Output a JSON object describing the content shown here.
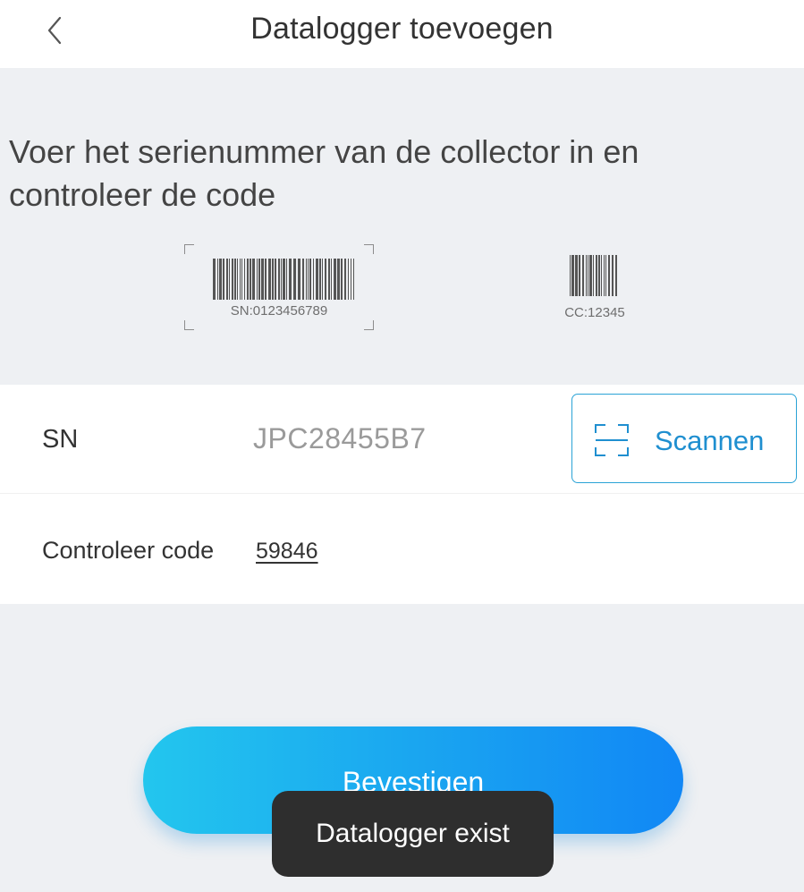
{
  "header": {
    "title": "Datalogger toevoegen"
  },
  "info": {
    "instruction": "Voer het serienummer van de collector in en controleer de code",
    "sn_example_label": "SN:0123456789",
    "cc_example_label": "CC:12345"
  },
  "sn_row": {
    "label": "SN",
    "value": "JPC28455B7",
    "scan_button_label": "Scannen"
  },
  "code_row": {
    "label": "Controleer code",
    "value": "59846"
  },
  "confirm_button": {
    "label": "Bevestigen"
  },
  "toast": {
    "text": "Datalogger exist"
  },
  "colors": {
    "accent": "#1f8fd0",
    "panel_background": "#eef0f3",
    "button_gradient_start": "#23c6ee",
    "button_gradient_end": "#1187f5",
    "toast_background": "#2e2e2e"
  },
  "icons": {
    "back": "chevron-left-icon",
    "scan": "scan-frame-icon"
  }
}
